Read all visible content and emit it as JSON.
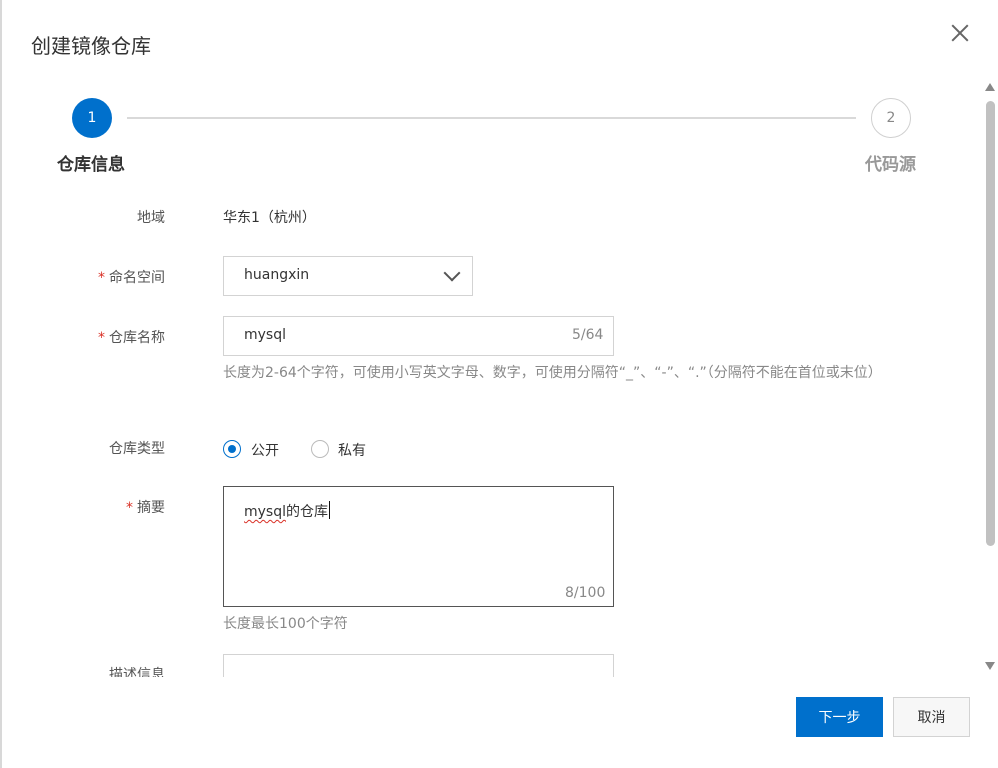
{
  "dialog": {
    "title": "创建镜像仓库"
  },
  "steps": [
    {
      "number": "1",
      "label": "仓库信息",
      "state": "active"
    },
    {
      "number": "2",
      "label": "代码源",
      "state": "pending"
    }
  ],
  "form": {
    "region": {
      "label": "地域",
      "value": "华东1（杭州）"
    },
    "namespace": {
      "label": "命名空间",
      "required_mark": "*",
      "value": "huangxin"
    },
    "repo_name": {
      "label": "仓库名称",
      "required_mark": "*",
      "value": "mysql",
      "counter": "5/64",
      "hint": "长度为2-64个字符，可使用小写英文字母、数字，可使用分隔符“_”、“-”、“.”（分隔符不能在首位或末位）"
    },
    "repo_type": {
      "label": "仓库类型",
      "options": [
        {
          "label": "公开",
          "selected": true
        },
        {
          "label": "私有",
          "selected": false
        }
      ]
    },
    "summary": {
      "label": "摘要",
      "required_mark": "*",
      "value_misspelled": "mysql",
      "value_rest": "的仓库",
      "counter": "8/100",
      "hint": "长度最长100个字符"
    },
    "description": {
      "label": "描述信息"
    }
  },
  "footer": {
    "next_label": "下一步",
    "cancel_label": "取消"
  },
  "colors": {
    "primary": "#0070cc",
    "required": "#d93026"
  }
}
